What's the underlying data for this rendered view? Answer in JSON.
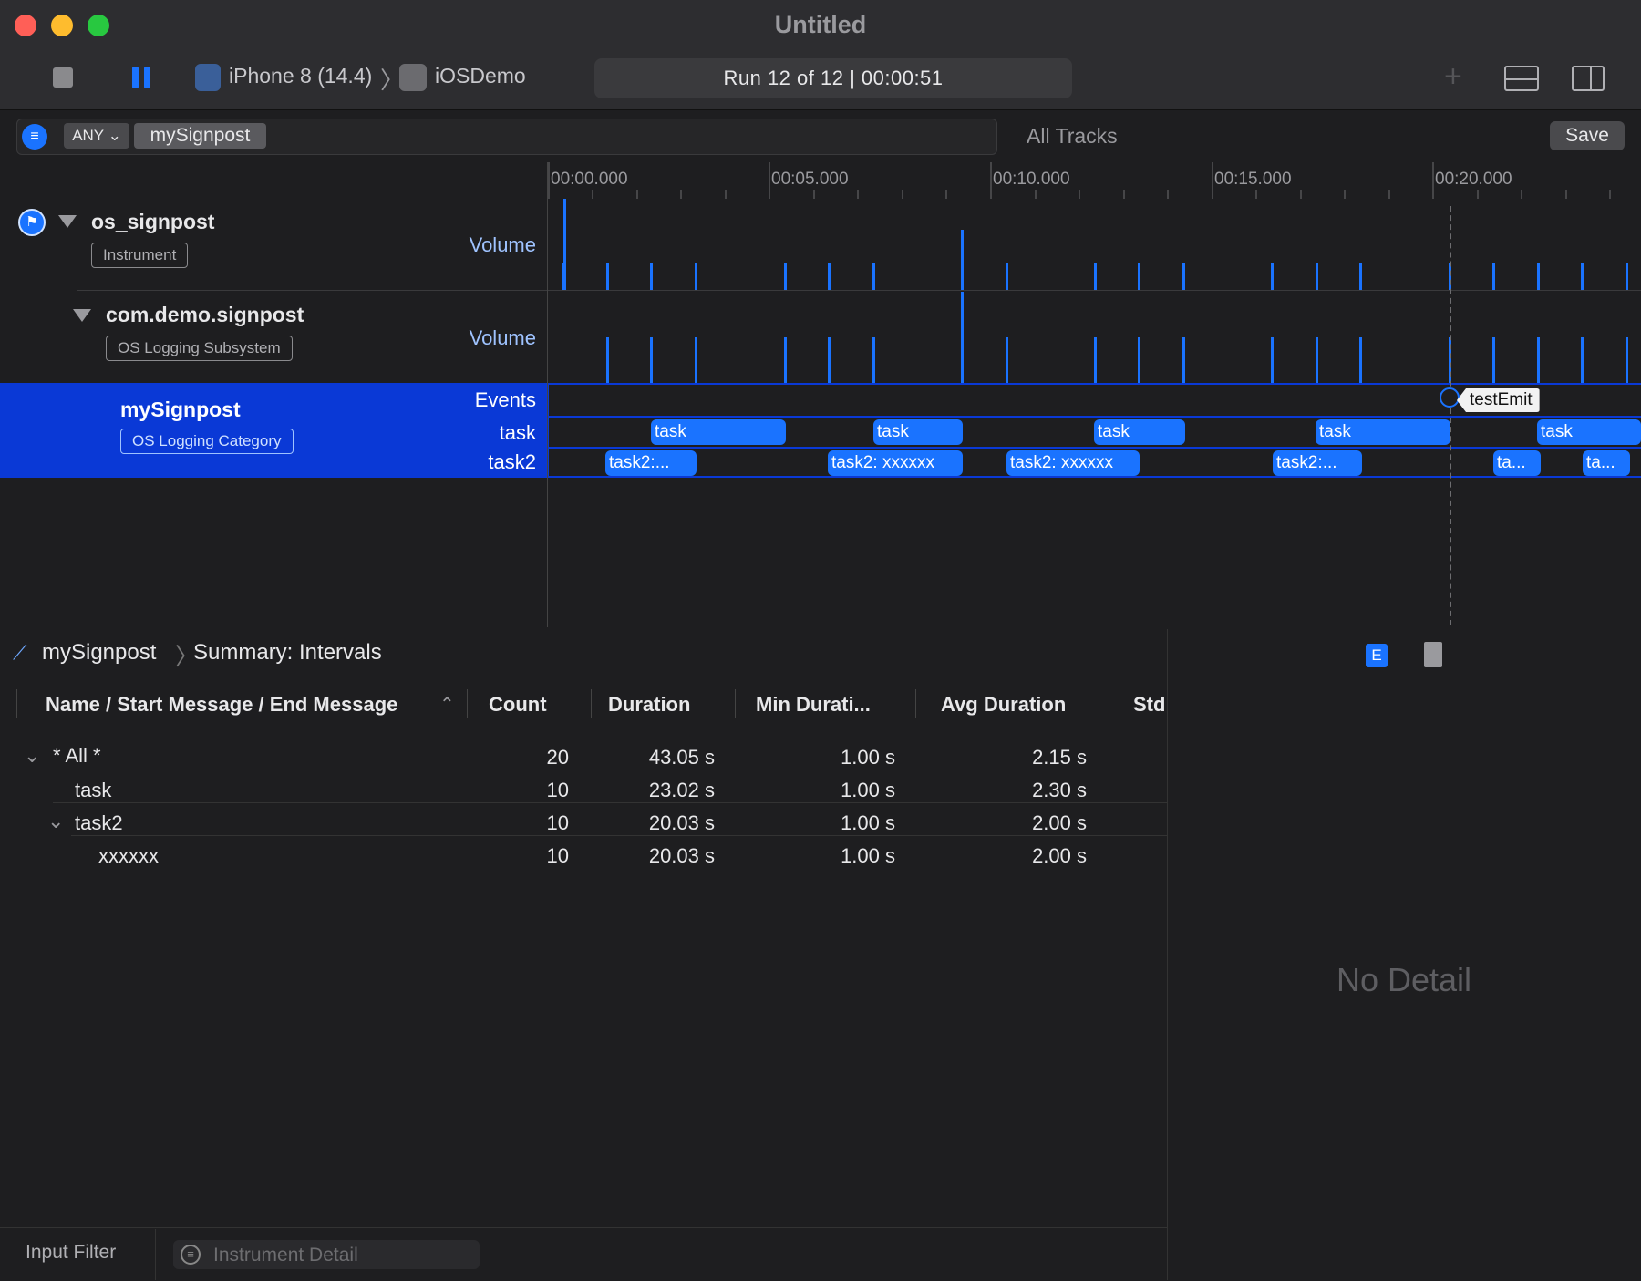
{
  "window": {
    "title": "Untitled"
  },
  "colors": {
    "close": "#ff5f57",
    "minimize": "#febc2e",
    "zoom": "#28c840",
    "accent": "#1a73ff",
    "selection": "#0a39d6"
  },
  "toolbar": {
    "device": "iPhone 8 (14.4)",
    "crumb_separator": "〉",
    "app": "iOSDemo",
    "run_status": "Run 12 of 12  |  00:00:51"
  },
  "filter": {
    "mode": "ANY",
    "token": "mySignpost",
    "scope": "All Tracks",
    "save_label": "Save"
  },
  "ruler": {
    "ticks": [
      "00:00.000",
      "00:05.000",
      "00:10.000",
      "00:15.000",
      "00:20.000"
    ]
  },
  "tracks": [
    {
      "name": "os_signpost",
      "badge": "Instrument",
      "lane_label": "Volume"
    },
    {
      "name": "com.demo.signpost",
      "badge": "OS Logging Subsystem",
      "lane_label": "Volume"
    },
    {
      "name": "mySignpost",
      "badge": "OS Logging Category",
      "lane_labels": [
        "Events",
        "task",
        "task2"
      ]
    }
  ],
  "timeline": {
    "event_marker": "testEmit",
    "task_intervals": [
      "task",
      "task",
      "task",
      "task",
      "task"
    ],
    "task2_intervals": [
      "task2:...",
      "task2: xxxxxx",
      "task2: xxxxxx",
      "task2:...",
      "ta...",
      "ta..."
    ]
  },
  "detail": {
    "instrument": "mySignpost",
    "view": "Summary: Intervals",
    "columns": [
      "Name / Start Message / End Message",
      "Count",
      "Duration",
      "Min Durati...",
      "Avg Duration",
      "Std"
    ],
    "rows": [
      {
        "name": "* All *",
        "count": "20",
        "duration": "43.05 s",
        "min": "1.00 s",
        "avg": "2.15 s"
      },
      {
        "name": "task",
        "count": "10",
        "duration": "23.02 s",
        "min": "1.00 s",
        "avg": "2.30 s"
      },
      {
        "name": "task2",
        "count": "10",
        "duration": "20.03 s",
        "min": "1.00 s",
        "avg": "2.00 s"
      },
      {
        "name": "xxxxxx",
        "count": "10",
        "duration": "20.03 s",
        "min": "1.00 s",
        "avg": "2.00 s"
      }
    ]
  },
  "inspector": {
    "ext_label": "E",
    "empty_text": "No Detail"
  },
  "bottom": {
    "input_filter": "Input Filter",
    "search_placeholder": "Instrument Detail"
  }
}
